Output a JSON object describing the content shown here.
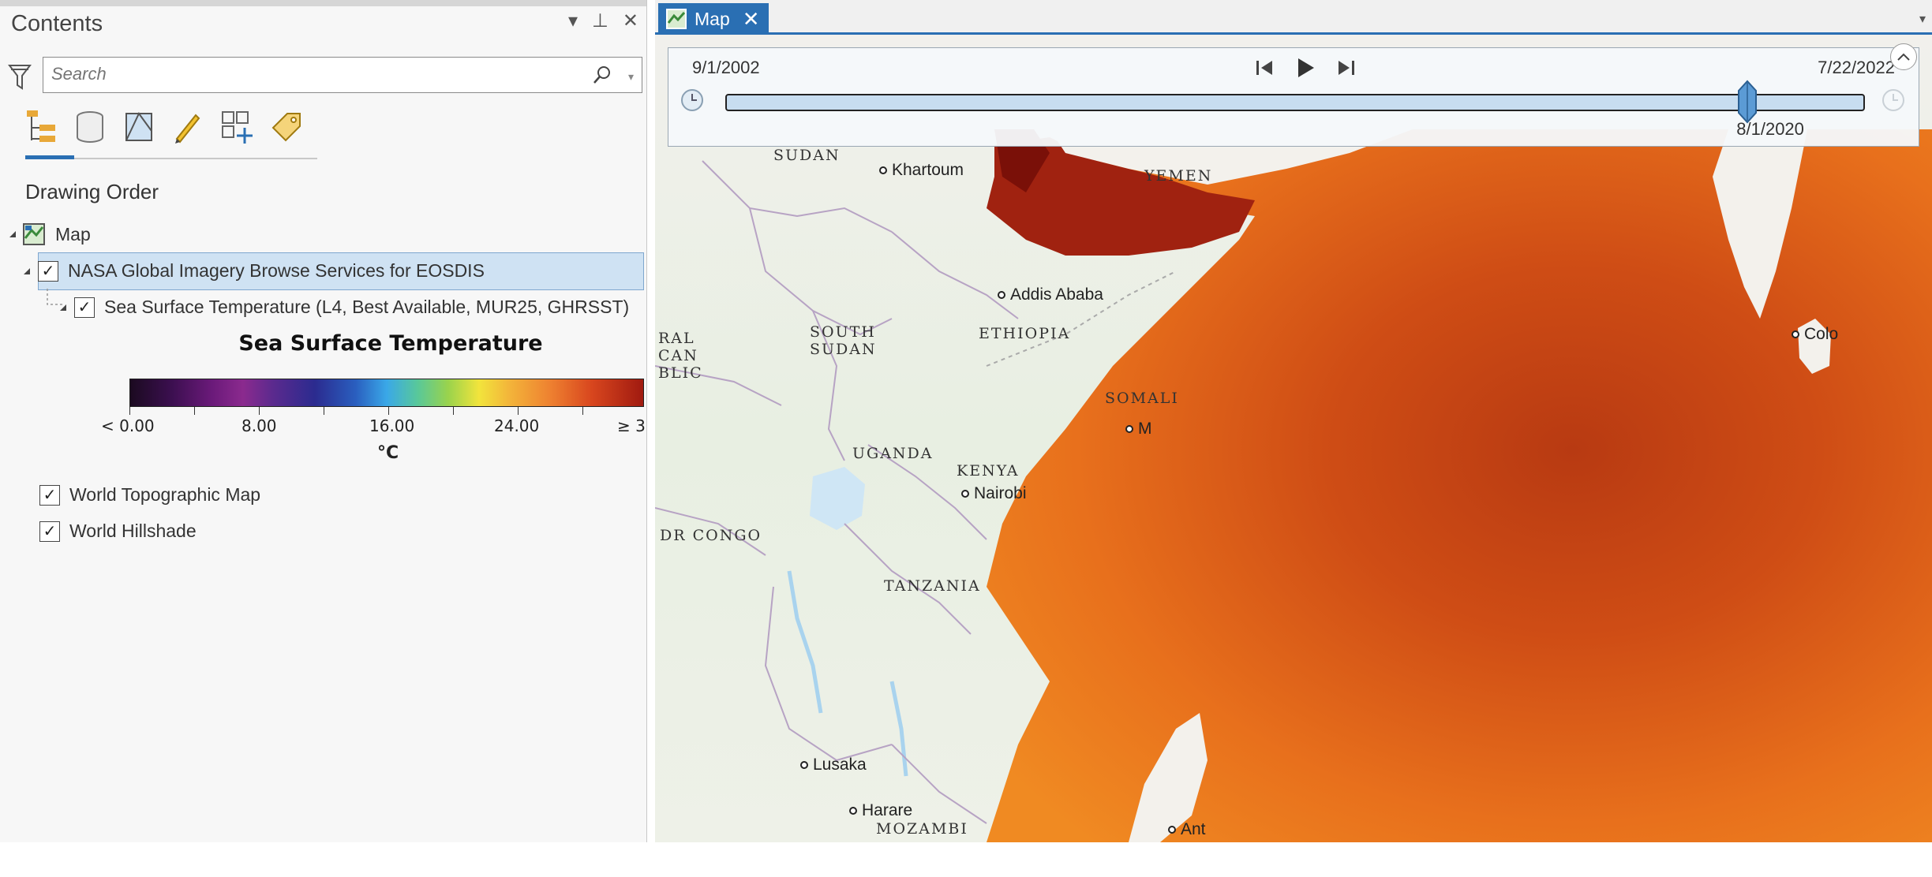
{
  "contents": {
    "title": "Contents",
    "controls": [
      "▾",
      "⊥",
      "✕"
    ],
    "search_placeholder": "Search",
    "toolbar_icons": [
      "list-by-drawing-order-icon",
      "list-by-data-source-icon",
      "list-by-selection-icon",
      "list-by-editing-icon",
      "list-by-snapping-icon",
      "list-by-labeling-icon"
    ],
    "drawing_order_label": "Drawing Order",
    "tree": {
      "map_label": "Map",
      "group_label": "NASA Global Imagery Browse Services for EOSDIS",
      "layer_label": "Sea Surface Temperature (L4, Best Available, MUR25, GHRSST)",
      "legend": {
        "title": "Sea Surface Temperature",
        "ticks": [
          "< 0.00",
          "8.00",
          "16.00",
          "24.00",
          "≥ 3"
        ],
        "unit": "°C"
      },
      "basemaps": [
        "World Topographic Map",
        "World Hillshade"
      ]
    }
  },
  "map": {
    "tab_label": "Map",
    "tab_close": "✕",
    "time_slider": {
      "start": "9/1/2002",
      "end": "7/22/2022",
      "current": "8/1/2020",
      "position_fraction": 0.897
    },
    "labels": {
      "sudan": "SUDAN",
      "yemen": "YEMEN",
      "ethiopia": "ETHIOPIA",
      "south_sudan_1": "SOUTH",
      "south_sudan_2": "SUDAN",
      "somalia": "SOMALI",
      "uganda": "UGANDA",
      "kenya": "KENYA",
      "tanzania": "TANZANIA",
      "dr_congo": "DR CONGO",
      "car_1": "RAL",
      "car_2": "CAN",
      "car_3": "BLIC",
      "mozambique": "MOZAMBI"
    },
    "cities": {
      "khartoum": "Khartoum",
      "addis": "Addis Ababa",
      "nairobi": "Nairobi",
      "lusaka": "Lusaka",
      "harare": "Harare",
      "colombo": "Colo",
      "mogadishu": "M",
      "antananarivo": "Ant"
    }
  }
}
